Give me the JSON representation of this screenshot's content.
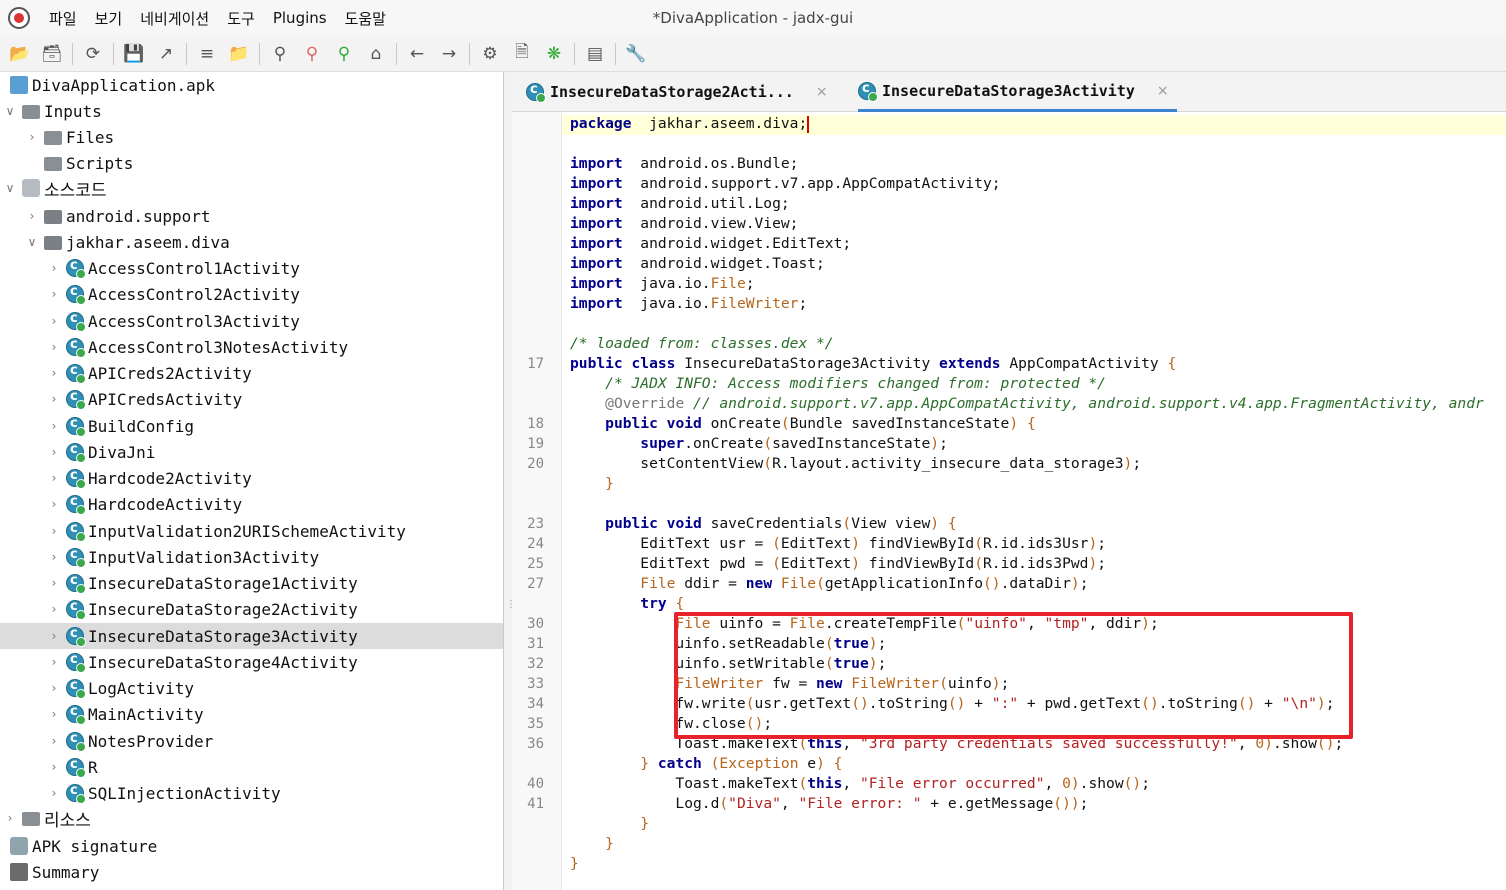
{
  "window": {
    "title": "*DivaApplication - jadx-gui"
  },
  "menu": [
    "파일",
    "보기",
    "네비게이션",
    "도구",
    "Plugins",
    "도움말"
  ],
  "toolbar": {
    "icons": [
      "open-file-icon",
      "add-files-icon",
      "sync-icon",
      "save-icon",
      "export-icon",
      "flatten-icon",
      "package-icon",
      "search-icon",
      "find-usage-icon",
      "find-class-icon",
      "home-icon",
      "back-icon",
      "forward-icon",
      "deobfuscation-icon",
      "quick-tab-icon",
      "debug-bug-icon",
      "log-icon",
      "preferences-wrench-icon"
    ]
  },
  "tree": {
    "items": [
      {
        "label": "DivaApplication.apk",
        "type": "apk",
        "indent": 0,
        "expand": ""
      },
      {
        "label": "Inputs",
        "type": "folder",
        "indent": 0,
        "expand": "open"
      },
      {
        "label": "Files",
        "type": "folder",
        "indent": 1,
        "expand": "closed"
      },
      {
        "label": "Scripts",
        "type": "folder",
        "indent": 1,
        "expand": ""
      },
      {
        "label": "소스코드",
        "type": "box",
        "indent": 0,
        "expand": "open"
      },
      {
        "label": "android.support",
        "type": "pkg",
        "indent": 1,
        "expand": "closed"
      },
      {
        "label": "jakhar.aseem.diva",
        "type": "pkg",
        "indent": 1,
        "expand": "open"
      },
      {
        "label": "AccessControl1Activity",
        "type": "class",
        "indent": 2,
        "expand": "closed"
      },
      {
        "label": "AccessControl2Activity",
        "type": "class",
        "indent": 2,
        "expand": "closed"
      },
      {
        "label": "AccessControl3Activity",
        "type": "class",
        "indent": 2,
        "expand": "closed"
      },
      {
        "label": "AccessControl3NotesActivity",
        "type": "class",
        "indent": 2,
        "expand": "closed"
      },
      {
        "label": "APICreds2Activity",
        "type": "class",
        "indent": 2,
        "expand": "closed"
      },
      {
        "label": "APICredsActivity",
        "type": "class",
        "indent": 2,
        "expand": "closed"
      },
      {
        "label": "BuildConfig",
        "type": "class",
        "indent": 2,
        "expand": "closed"
      },
      {
        "label": "DivaJni",
        "type": "class",
        "indent": 2,
        "expand": "closed"
      },
      {
        "label": "Hardcode2Activity",
        "type": "class",
        "indent": 2,
        "expand": "closed"
      },
      {
        "label": "HardcodeActivity",
        "type": "class",
        "indent": 2,
        "expand": "closed"
      },
      {
        "label": "InputValidation2URISchemeActivity",
        "type": "class",
        "indent": 2,
        "expand": "closed"
      },
      {
        "label": "InputValidation3Activity",
        "type": "class",
        "indent": 2,
        "expand": "closed"
      },
      {
        "label": "InsecureDataStorage1Activity",
        "type": "class",
        "indent": 2,
        "expand": "closed"
      },
      {
        "label": "InsecureDataStorage2Activity",
        "type": "class",
        "indent": 2,
        "expand": "closed"
      },
      {
        "label": "InsecureDataStorage3Activity",
        "type": "class",
        "indent": 2,
        "expand": "closed",
        "selected": true
      },
      {
        "label": "InsecureDataStorage4Activity",
        "type": "class",
        "indent": 2,
        "expand": "closed"
      },
      {
        "label": "LogActivity",
        "type": "class",
        "indent": 2,
        "expand": "closed"
      },
      {
        "label": "MainActivity",
        "type": "class",
        "indent": 2,
        "expand": "closed"
      },
      {
        "label": "NotesProvider",
        "type": "class",
        "indent": 2,
        "expand": "closed"
      },
      {
        "label": "R",
        "type": "class",
        "indent": 2,
        "expand": "closed"
      },
      {
        "label": "SQLInjectionActivity",
        "type": "class",
        "indent": 2,
        "expand": "closed"
      },
      {
        "label": "리소스",
        "type": "folder",
        "indent": 0,
        "expand": "closed"
      },
      {
        "label": "APK signature",
        "type": "sig",
        "indent": 0,
        "expand": ""
      },
      {
        "label": "Summary",
        "type": "summary",
        "indent": 0,
        "expand": ""
      }
    ]
  },
  "tabs": [
    {
      "label": "InsecureDataStorage2Acti...",
      "close": "×",
      "active": false
    },
    {
      "label": "InsecureDataStorage3Activity",
      "close": "×",
      "active": true
    }
  ],
  "code": {
    "lines": [
      {
        "n": "",
        "t": [
          [
            "kw",
            "package"
          ],
          [
            "",
            "  jakhar.aseem.diva;"
          ]
        ],
        "caret": true
      },
      {
        "n": "",
        "t": []
      },
      {
        "n": "",
        "t": [
          [
            "kw",
            "import"
          ],
          [
            "",
            "  android.os.Bundle;"
          ]
        ]
      },
      {
        "n": "",
        "t": [
          [
            "kw",
            "import"
          ],
          [
            "",
            "  android.support.v7.app.AppCompatActivity;"
          ]
        ]
      },
      {
        "n": "",
        "t": [
          [
            "kw",
            "import"
          ],
          [
            "",
            "  android.util.Log;"
          ]
        ]
      },
      {
        "n": "",
        "t": [
          [
            "kw",
            "import"
          ],
          [
            "",
            "  android.view.View;"
          ]
        ]
      },
      {
        "n": "",
        "t": [
          [
            "kw",
            "import"
          ],
          [
            "",
            "  android.widget.EditText;"
          ]
        ]
      },
      {
        "n": "",
        "t": [
          [
            "kw",
            "import"
          ],
          [
            "",
            "  android.widget.Toast;"
          ]
        ]
      },
      {
        "n": "",
        "t": [
          [
            "kw",
            "import"
          ],
          [
            "",
            "  java.io."
          ],
          [
            "typ",
            "File"
          ],
          [
            "",
            ";"
          ]
        ]
      },
      {
        "n": "",
        "t": [
          [
            "kw",
            "import"
          ],
          [
            "",
            "  java.io."
          ],
          [
            "typ",
            "FileWriter"
          ],
          [
            "",
            ";"
          ]
        ]
      },
      {
        "n": "",
        "t": []
      },
      {
        "n": "",
        "t": [
          [
            "cm",
            "/* loaded from: classes.dex */"
          ]
        ]
      },
      {
        "n": "17",
        "t": [
          [
            "kw",
            "public class"
          ],
          [
            "",
            " InsecureDataStorage3Activity "
          ],
          [
            "kw",
            "extends"
          ],
          [
            "",
            " AppCompatActivity "
          ],
          [
            "par",
            "{"
          ]
        ]
      },
      {
        "n": "",
        "t": [
          [
            "",
            "    "
          ],
          [
            "cm",
            "/* JADX INFO: Access modifiers changed from: protected */"
          ]
        ]
      },
      {
        "n": "",
        "t": [
          [
            "",
            "    "
          ],
          [
            "ann",
            "@Override"
          ],
          [
            "",
            " "
          ],
          [
            "cm",
            "// android.support.v7.app.AppCompatActivity, android.support.v4.app.FragmentActivity, andr"
          ]
        ]
      },
      {
        "n": "18",
        "t": [
          [
            "",
            "    "
          ],
          [
            "kw",
            "public void"
          ],
          [
            "",
            " onCreate"
          ],
          [
            "par",
            "("
          ],
          [
            "",
            "Bundle savedInstanceState"
          ],
          [
            "par",
            ")"
          ],
          [
            "",
            " "
          ],
          [
            "par",
            "{"
          ]
        ]
      },
      {
        "n": "19",
        "t": [
          [
            "",
            "        "
          ],
          [
            "kw",
            "super"
          ],
          [
            "",
            ".onCreate"
          ],
          [
            "par",
            "("
          ],
          [
            "",
            "savedInstanceState"
          ],
          [
            "par",
            ")"
          ],
          [
            "",
            ";"
          ]
        ]
      },
      {
        "n": "20",
        "t": [
          [
            "",
            "        setContentView"
          ],
          [
            "par",
            "("
          ],
          [
            "",
            "R.layout.activity_insecure_data_storage3"
          ],
          [
            "par",
            ")"
          ],
          [
            "",
            ";"
          ]
        ]
      },
      {
        "n": "",
        "t": [
          [
            "",
            "    "
          ],
          [
            "par",
            "}"
          ]
        ]
      },
      {
        "n": "",
        "t": []
      },
      {
        "n": "23",
        "t": [
          [
            "",
            "    "
          ],
          [
            "kw",
            "public void"
          ],
          [
            "",
            " saveCredentials"
          ],
          [
            "par",
            "("
          ],
          [
            "",
            "View view"
          ],
          [
            "par",
            ")"
          ],
          [
            "",
            " "
          ],
          [
            "par",
            "{"
          ]
        ]
      },
      {
        "n": "24",
        "t": [
          [
            "",
            "        EditText usr = "
          ],
          [
            "par",
            "("
          ],
          [
            "",
            "EditText"
          ],
          [
            "par",
            ")"
          ],
          [
            "",
            " findViewById"
          ],
          [
            "par",
            "("
          ],
          [
            "",
            "R.id.ids3Usr"
          ],
          [
            "par",
            ")"
          ],
          [
            "",
            ";"
          ]
        ]
      },
      {
        "n": "25",
        "t": [
          [
            "",
            "        EditText pwd = "
          ],
          [
            "par",
            "("
          ],
          [
            "",
            "EditText"
          ],
          [
            "par",
            ")"
          ],
          [
            "",
            " findViewById"
          ],
          [
            "par",
            "("
          ],
          [
            "",
            "R.id.ids3Pwd"
          ],
          [
            "par",
            ")"
          ],
          [
            "",
            ";"
          ]
        ]
      },
      {
        "n": "27",
        "t": [
          [
            "",
            "        "
          ],
          [
            "typ",
            "File"
          ],
          [
            "",
            " ddir = "
          ],
          [
            "kw",
            "new"
          ],
          [
            "",
            " "
          ],
          [
            "typ",
            "File"
          ],
          [
            "par",
            "("
          ],
          [
            "",
            "getApplicationInfo"
          ],
          [
            "par",
            "()"
          ],
          [
            "",
            ".dataDir"
          ],
          [
            "par",
            ")"
          ],
          [
            "",
            ";"
          ]
        ]
      },
      {
        "n": "",
        "t": [
          [
            "",
            "        "
          ],
          [
            "kw",
            "try"
          ],
          [
            "",
            " "
          ],
          [
            "par",
            "{"
          ]
        ]
      },
      {
        "n": "30",
        "t": [
          [
            "",
            "            "
          ],
          [
            "typ",
            "File"
          ],
          [
            "",
            " uinfo = "
          ],
          [
            "typ",
            "File"
          ],
          [
            "",
            ".createTempFile"
          ],
          [
            "par",
            "("
          ],
          [
            "str",
            "\"uinfo\""
          ],
          [
            "",
            ", "
          ],
          [
            "str",
            "\"tmp\""
          ],
          [
            "",
            ", ddir"
          ],
          [
            "par",
            ")"
          ],
          [
            "",
            ";"
          ]
        ]
      },
      {
        "n": "31",
        "t": [
          [
            "",
            "            uinfo.setReadable"
          ],
          [
            "par",
            "("
          ],
          [
            "kw",
            "true"
          ],
          [
            "par",
            ")"
          ],
          [
            "",
            ";"
          ]
        ]
      },
      {
        "n": "32",
        "t": [
          [
            "",
            "            uinfo.setWritable"
          ],
          [
            "par",
            "("
          ],
          [
            "kw",
            "true"
          ],
          [
            "par",
            ")"
          ],
          [
            "",
            ";"
          ]
        ]
      },
      {
        "n": "33",
        "t": [
          [
            "",
            "            "
          ],
          [
            "typ",
            "FileWriter"
          ],
          [
            "",
            " fw = "
          ],
          [
            "kw",
            "new"
          ],
          [
            "",
            " "
          ],
          [
            "typ",
            "FileWriter"
          ],
          [
            "par",
            "("
          ],
          [
            "",
            "uinfo"
          ],
          [
            "par",
            ")"
          ],
          [
            "",
            ";"
          ]
        ]
      },
      {
        "n": "34",
        "t": [
          [
            "",
            "            fw.write"
          ],
          [
            "par",
            "("
          ],
          [
            "",
            "usr.getText"
          ],
          [
            "par",
            "()"
          ],
          [
            "",
            ".toString"
          ],
          [
            "par",
            "()"
          ],
          [
            "",
            " + "
          ],
          [
            "str",
            "\":\""
          ],
          [
            "",
            " + pwd.getText"
          ],
          [
            "par",
            "()"
          ],
          [
            "",
            ".toString"
          ],
          [
            "par",
            "()"
          ],
          [
            "",
            " + "
          ],
          [
            "str",
            "\"\\n\""
          ],
          [
            "par",
            ")"
          ],
          [
            "",
            ";"
          ]
        ]
      },
      {
        "n": "35",
        "t": [
          [
            "",
            "            fw.close"
          ],
          [
            "par",
            "()"
          ],
          [
            "",
            ";"
          ]
        ]
      },
      {
        "n": "36",
        "t": [
          [
            "",
            "            Toast.makeText"
          ],
          [
            "par",
            "("
          ],
          [
            "kw",
            "this"
          ],
          [
            "",
            ", "
          ],
          [
            "str",
            "\"3rd party credentials saved successfully!\""
          ],
          [
            "",
            ", "
          ],
          [
            "par",
            "0"
          ],
          [
            "par",
            ")"
          ],
          [
            "",
            ".show"
          ],
          [
            "par",
            "()"
          ],
          [
            "",
            ";"
          ]
        ]
      },
      {
        "n": "",
        "t": [
          [
            "",
            "        "
          ],
          [
            "par",
            "}"
          ],
          [
            "",
            " "
          ],
          [
            "kw",
            "catch"
          ],
          [
            "",
            " "
          ],
          [
            "par",
            "("
          ],
          [
            "typ",
            "Exception"
          ],
          [
            "",
            " e"
          ],
          [
            "par",
            ")"
          ],
          [
            "",
            " "
          ],
          [
            "par",
            "{"
          ]
        ]
      },
      {
        "n": "40",
        "t": [
          [
            "",
            "            Toast.makeText"
          ],
          [
            "par",
            "("
          ],
          [
            "kw",
            "this"
          ],
          [
            "",
            ", "
          ],
          [
            "str",
            "\"File error occurred\""
          ],
          [
            "",
            ", "
          ],
          [
            "par",
            "0"
          ],
          [
            "par",
            ")"
          ],
          [
            "",
            ".show"
          ],
          [
            "par",
            "()"
          ],
          [
            "",
            ";"
          ]
        ]
      },
      {
        "n": "41",
        "t": [
          [
            "",
            "            Log.d"
          ],
          [
            "par",
            "("
          ],
          [
            "str",
            "\"Diva\""
          ],
          [
            "",
            ", "
          ],
          [
            "str",
            "\"File error: \""
          ],
          [
            "",
            " + e.getMessage"
          ],
          [
            "par",
            "()"
          ],
          [
            "par",
            ")"
          ],
          [
            "",
            ";"
          ]
        ]
      },
      {
        "n": "",
        "t": [
          [
            "",
            "        "
          ],
          [
            "par",
            "}"
          ]
        ]
      },
      {
        "n": "",
        "t": [
          [
            "",
            "    "
          ],
          [
            "par",
            "}"
          ]
        ]
      },
      {
        "n": "",
        "t": [
          [
            "par",
            "}"
          ]
        ]
      }
    ]
  },
  "colors": {
    "highlight_box": "#e8212a",
    "keyword": "#00008b",
    "string": "#b22222",
    "comment": "#2c6e2c",
    "type": "#b5651d",
    "tab_indicator": "#3c84d0"
  }
}
